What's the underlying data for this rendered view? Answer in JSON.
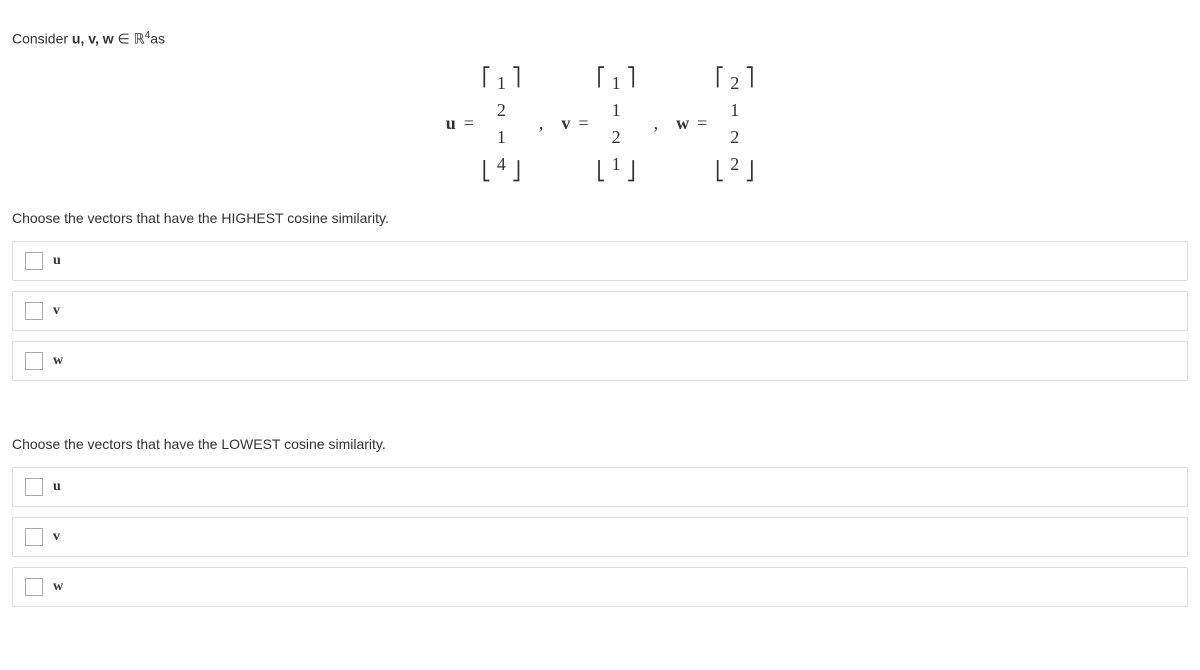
{
  "intro": {
    "prefix": "Consider ",
    "vectors": "u, v, w",
    "member": " ∈ ℝ",
    "exponent": "4",
    "suffix": "as"
  },
  "vectors": {
    "u": {
      "label": "u",
      "values": [
        "1",
        "2",
        "1",
        "4"
      ]
    },
    "v": {
      "label": "v",
      "values": [
        "1",
        "1",
        "2",
        "1"
      ]
    },
    "w": {
      "label": "w",
      "values": [
        "2",
        "1",
        "2",
        "2"
      ]
    }
  },
  "eq": "=",
  "comma": ",",
  "q1": {
    "text": "Choose the vectors that have the HIGHEST cosine similarity.",
    "options": [
      "u",
      "v",
      "w"
    ]
  },
  "q2": {
    "text": "Choose the vectors that have the LOWEST cosine similarity.",
    "options": [
      "u",
      "v",
      "w"
    ]
  }
}
